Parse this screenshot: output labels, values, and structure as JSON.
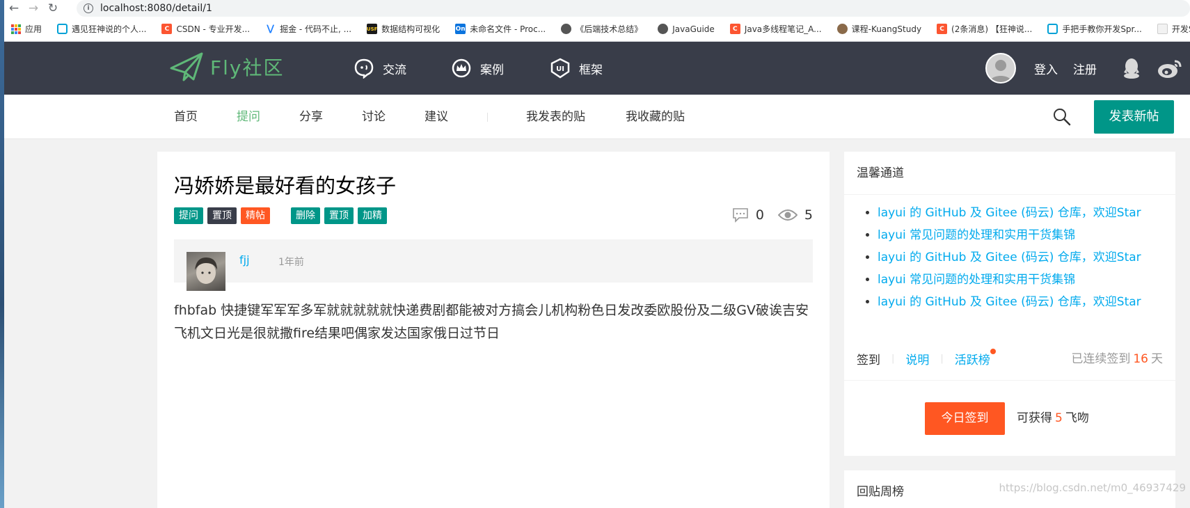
{
  "browser": {
    "url": "localhost:8080/detail/1",
    "bookmarks": [
      {
        "label": "应用",
        "icon": "apps-grid-icon"
      },
      {
        "label": "遇见狂神说的个人...",
        "icon": "bilibili-icon"
      },
      {
        "label": "CSDN - 专业开发...",
        "icon": "csdn-icon"
      },
      {
        "label": "掘金 - 代码不止, ...",
        "icon": "juejin-icon"
      },
      {
        "label": "数据结构可视化",
        "icon": "usf-icon"
      },
      {
        "label": "未命名文件 - Proc...",
        "icon": "processon-icon"
      },
      {
        "label": "《后端技术总结》",
        "icon": "globe-icon"
      },
      {
        "label": "JavaGuide",
        "icon": "globe-icon"
      },
      {
        "label": "Java多线程笔记_A...",
        "icon": "csdn-icon"
      },
      {
        "label": "课程-KuangStudy",
        "icon": "kuang-icon"
      },
      {
        "label": "(2条消息) 【狂神说...",
        "icon": "csdn-icon"
      },
      {
        "label": "手把手教你开发Spr...",
        "icon": "bilibili-icon"
      },
      {
        "label": "开发SpringB",
        "icon": "page-icon"
      }
    ]
  },
  "header": {
    "logo_text": "Fly社区",
    "nav": [
      {
        "label": "交流",
        "icon": "chat-bubble-icon"
      },
      {
        "label": "案例",
        "icon": "crown-icon"
      },
      {
        "label": "框架",
        "icon": "layui-shield-icon"
      }
    ],
    "login": "登入",
    "register": "注册"
  },
  "subnav": {
    "items": [
      "首页",
      "提问",
      "分享",
      "讨论",
      "建议"
    ],
    "active": "提问",
    "my_posts": "我发表的贴",
    "my_favorites": "我收藏的贴",
    "post_button": "发表新帖"
  },
  "post": {
    "title": "冯娇娇是最好看的女孩子",
    "tags": [
      "提问",
      "置顶",
      "精帖"
    ],
    "admin_actions": [
      "删除",
      "置顶",
      "加精"
    ],
    "comment_count": "0",
    "view_count": "5",
    "author": "fjj",
    "time": "1年前",
    "content": "fhbfab 快捷键军军军多军就就就就就快递费剧都能被对方搞会儿机构粉色日发改委欧股份及二级GV破诶吉安飞机文日光是很就撒fire结果吧偶家发达国家俄日过节日"
  },
  "sidebar": {
    "tips_title": "温馨通道",
    "tips": [
      "layui 的 GitHub 及 Gitee (码云) 仓库，欢迎Star",
      "layui 常见问题的处理和实用干货集锦",
      "layui 的 GitHub 及 Gitee (码云) 仓库，欢迎Star",
      "layui 常见问题的处理和实用干货集锦",
      "layui 的 GitHub 及 Gitee (码云) 仓库，欢迎Star"
    ],
    "sign": {
      "tab_sign": "签到",
      "tab_desc": "说明",
      "tab_rank": "活跃榜",
      "streak_prefix": "已连续签到",
      "streak_days": "16",
      "streak_suffix": "天",
      "button": "今日签到",
      "earn_prefix": "可获得",
      "earn_amount": "5",
      "earn_suffix": "飞吻"
    },
    "reply_rank_title": "回贴周榜"
  },
  "watermark": "https://blog.csdn.net/m0_46937429",
  "colors": {
    "header_bg": "#393d49",
    "accent_green": "#5fb878",
    "teal": "#009688",
    "orange": "#ff5722",
    "link_blue": "#01aaed"
  }
}
